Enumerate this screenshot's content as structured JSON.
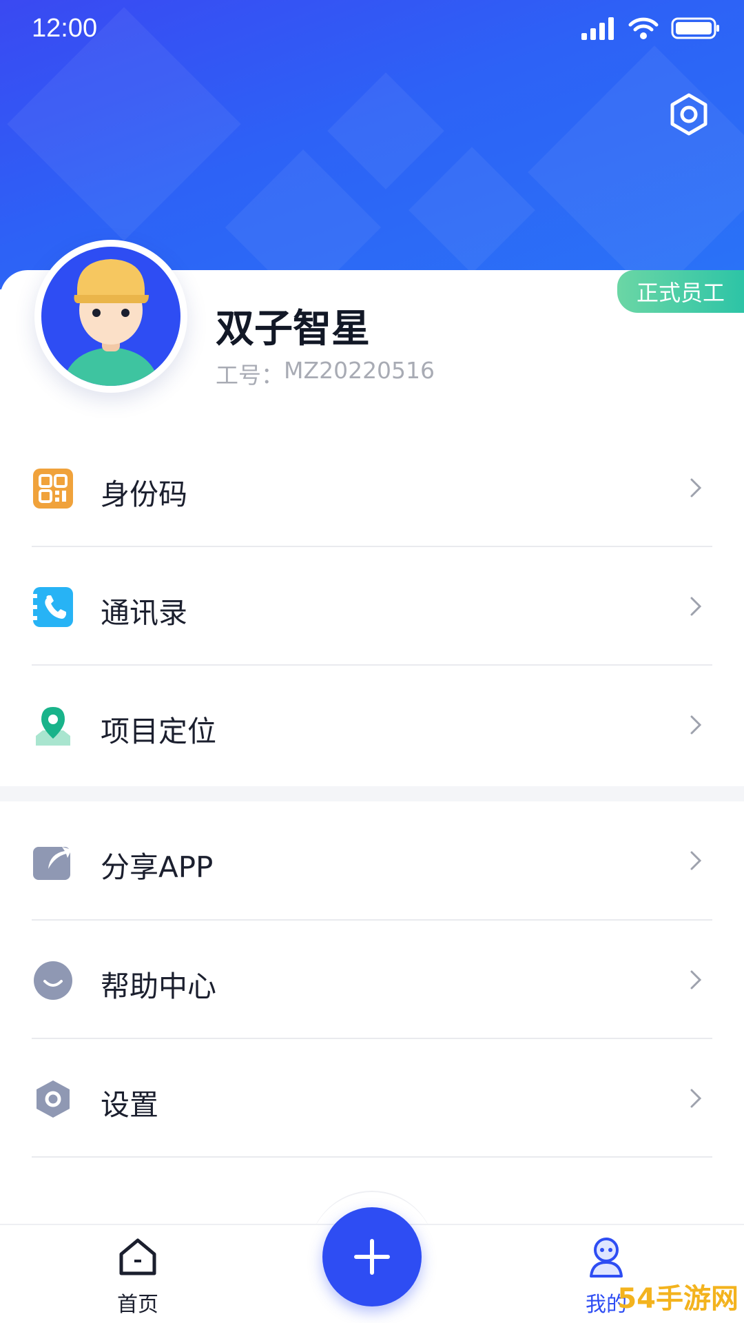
{
  "status_bar": {
    "time": "12:00"
  },
  "profile": {
    "name": "双子智星",
    "employee_id_label": "工号：",
    "employee_id": "MZ20220516",
    "badge": "正式员工"
  },
  "menu_group_1": [
    {
      "label": "身份码",
      "icon": "qr-code-icon",
      "color": "#f0a23b"
    },
    {
      "label": "通讯录",
      "icon": "phone-book-icon",
      "color": "#27b3f5"
    },
    {
      "label": "项目定位",
      "icon": "location-pin-icon",
      "color": "#19b38a"
    }
  ],
  "menu_group_2": [
    {
      "label": "分享APP",
      "icon": "share-icon",
      "color": "#8f98b3"
    },
    {
      "label": "帮助中心",
      "icon": "help-icon",
      "color": "#8f98b3"
    },
    {
      "label": "设置",
      "icon": "settings-icon",
      "color": "#8f98b3"
    }
  ],
  "bottom_nav": {
    "home": "首页",
    "mine": "我的",
    "active": "我的"
  },
  "watermark": "54手游网",
  "colors": {
    "primary": "#2e4df3",
    "badge": "#2dc4a6"
  }
}
